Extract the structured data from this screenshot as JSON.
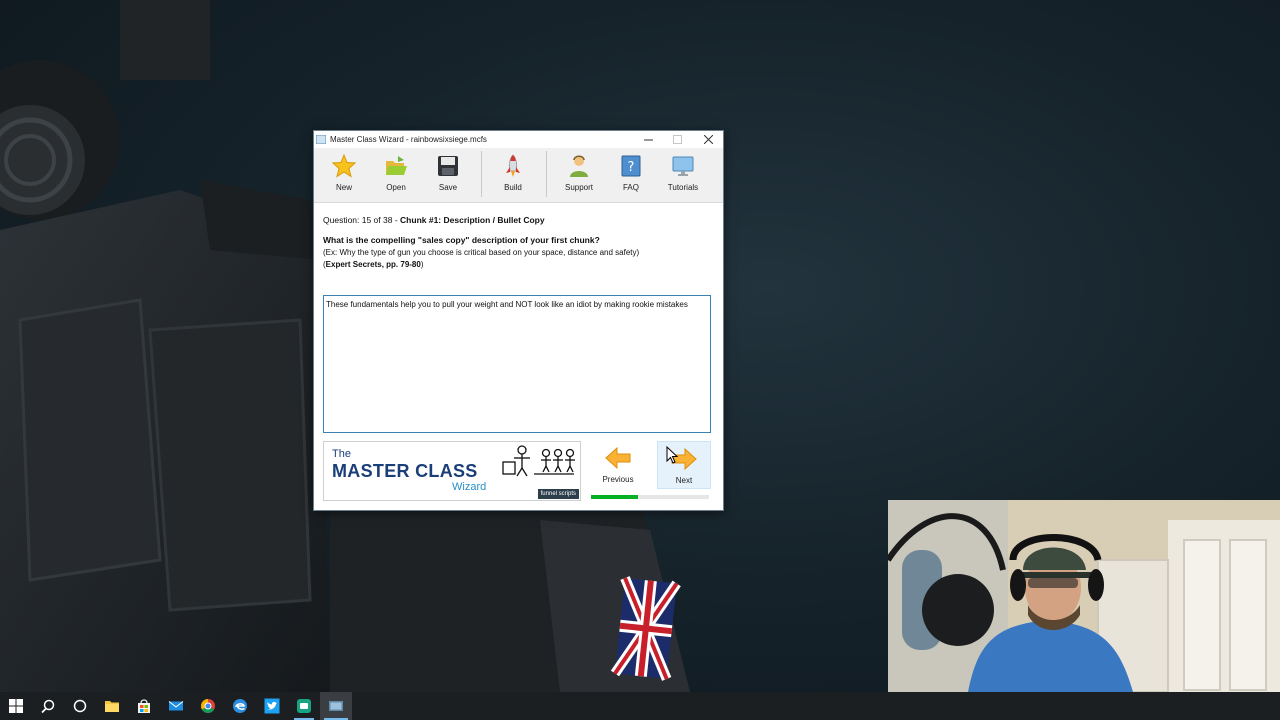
{
  "window": {
    "title": "Master Class Wizard - rainbowsixsiege.mcfs"
  },
  "toolbar": {
    "new_label": "New",
    "open_label": "Open",
    "save_label": "Save",
    "build_label": "Build",
    "support_label": "Support",
    "faq_label": "FAQ",
    "tutorials_label": "Tutorials"
  },
  "question": {
    "counter": "Question: 15 of 38 -",
    "chunk_title": "Chunk #1: Description / Bullet Copy",
    "prompt": "What is the compelling \"sales copy\" description of your first chunk?",
    "example": "(Ex: Why the type of gun you choose is critical based on your space, distance and safety)",
    "reference_open": "(",
    "reference": "Expert Secrets, pp. 79-80",
    "reference_close": ")"
  },
  "answer": {
    "value": "These fundamentals help you to pull your weight and NOT look like an idiot by making rookie mistakes"
  },
  "banner": {
    "the": "The",
    "master_class": "MASTER CLASS",
    "wizard": "Wizard",
    "badge": "funnel scripts"
  },
  "nav": {
    "previous_label": "Previous",
    "next_label": "Next",
    "progress_fraction": 0.3947
  },
  "colors": {
    "accent": "#3c7fb1",
    "progress": "#06b025",
    "brand_navy": "#1a3e78",
    "brand_blue": "#2a8fc9"
  },
  "taskbar": {
    "icons": [
      "windows-start-icon",
      "search-icon",
      "cortana-icon",
      "file-explorer-icon",
      "store-icon",
      "mail-icon",
      "chrome-icon",
      "edge-icon",
      "twitter-icon",
      "app-icon",
      "master-class-wizard-icon"
    ]
  }
}
